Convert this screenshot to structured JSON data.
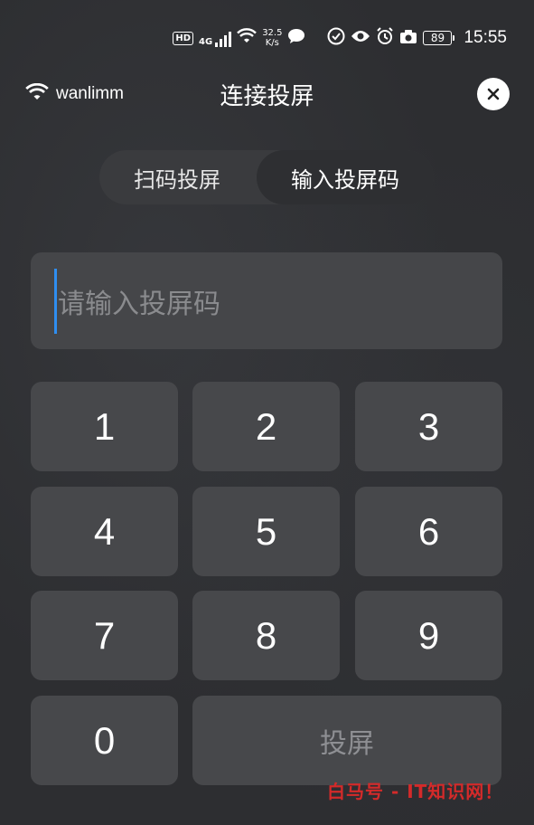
{
  "status_bar": {
    "hd": "HD",
    "network": "4G",
    "speed_value": "32.5",
    "speed_unit": "K/s",
    "battery": "89",
    "time": "15:55"
  },
  "header": {
    "wifi_name": "wanlimm",
    "title": "连接投屏"
  },
  "tabs": {
    "scan": "扫码投屏",
    "input": "输入投屏码",
    "active": "input"
  },
  "code_input": {
    "placeholder": "请输入投屏码",
    "value": ""
  },
  "keypad": {
    "k1": "1",
    "k2": "2",
    "k3": "3",
    "k4": "4",
    "k5": "5",
    "k6": "6",
    "k7": "7",
    "k8": "8",
    "k9": "9",
    "k0": "0",
    "cast": "投屏"
  },
  "watermark": "白马号 - IT知识网！",
  "colors": {
    "background": "#2d2e31",
    "key": "#47484b",
    "caret": "#2f8ef0",
    "watermark": "#d42a2a"
  }
}
